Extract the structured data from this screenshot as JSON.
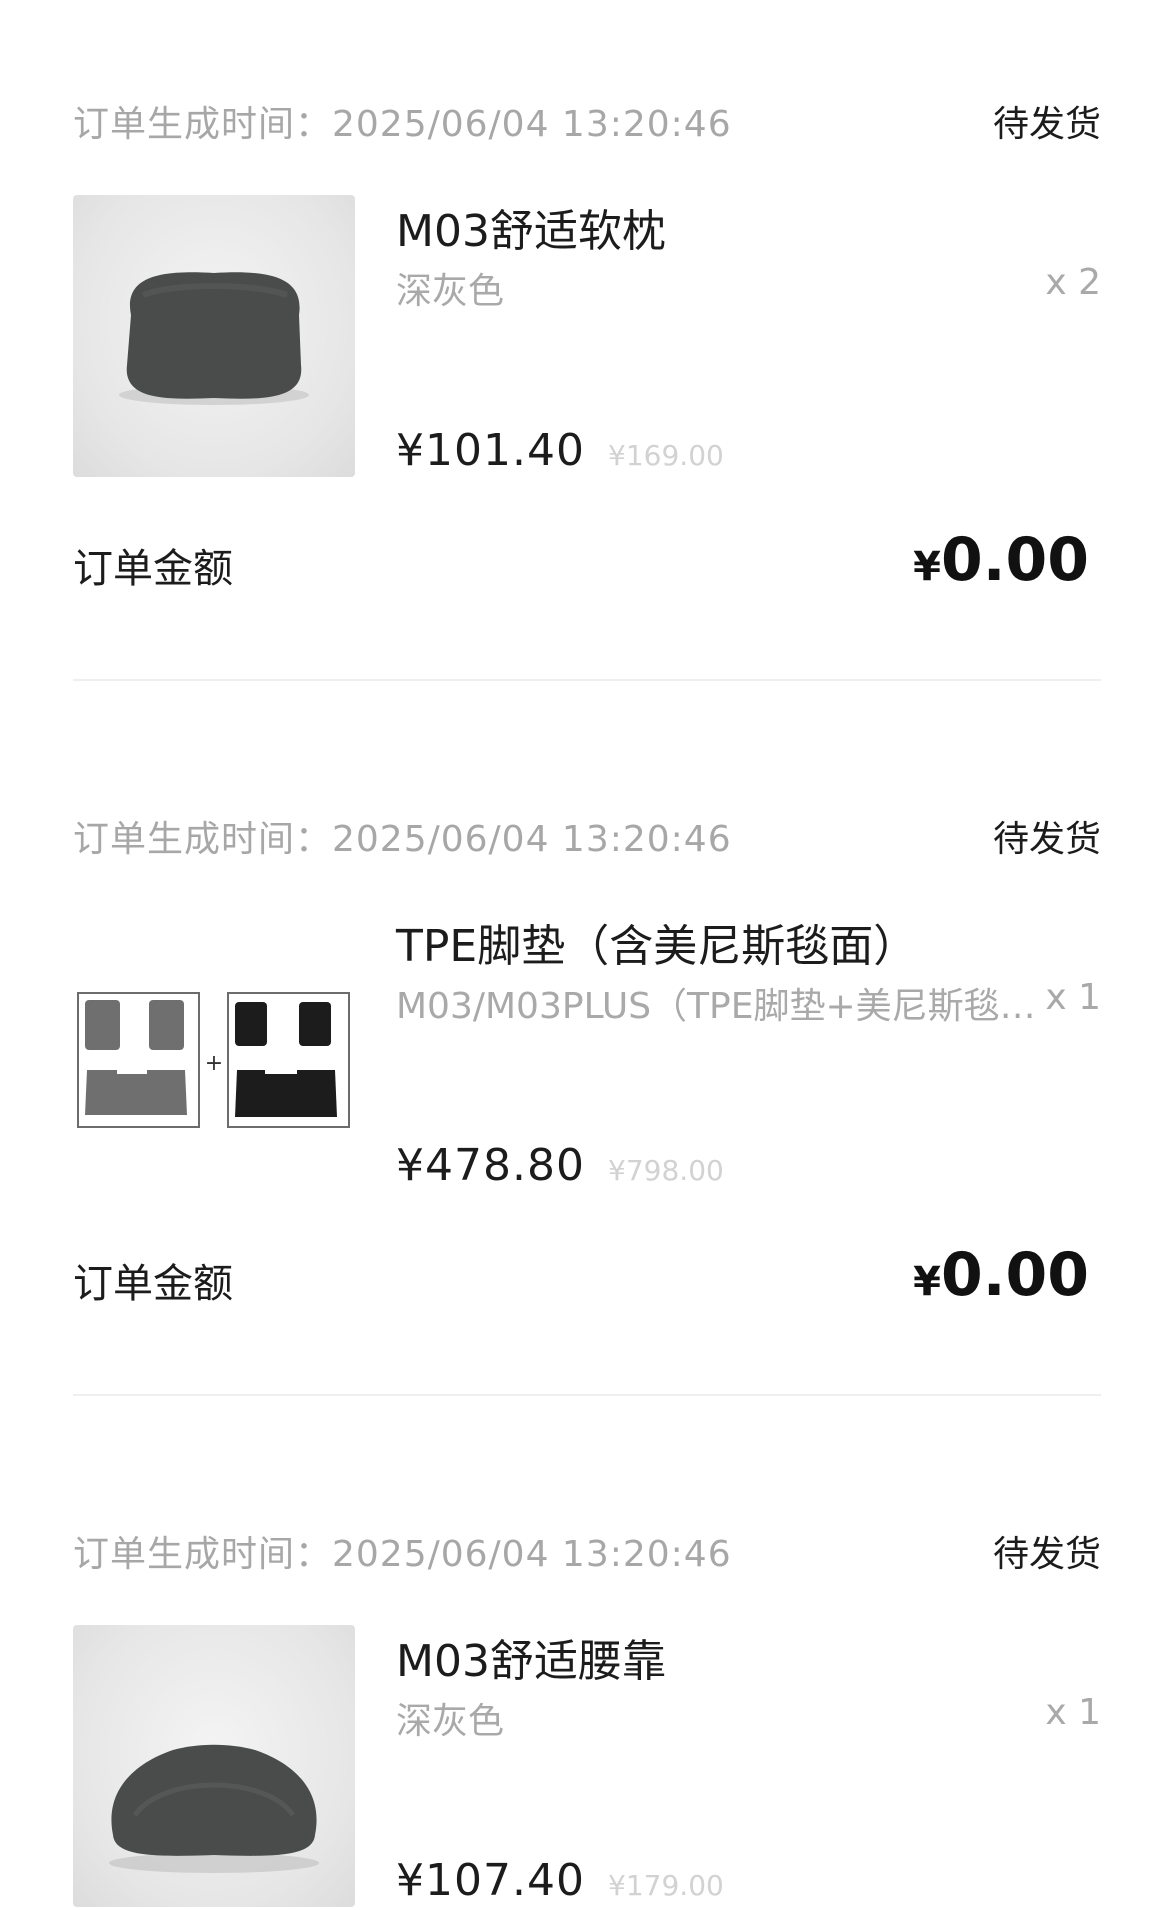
{
  "orders": [
    {
      "time": "订单生成时间：2025/06/04 13:20:46",
      "status": "待发货",
      "product_name": "M03舒适软枕",
      "variant": "深灰色",
      "qty": "x 2",
      "price": "¥101.40",
      "orig_price": "¥169.00",
      "total_label": "订单金额",
      "total_yen": "¥",
      "total_amount": "0.00",
      "image_icon": "headrest-pillow-icon"
    },
    {
      "time": "订单生成时间：2025/06/04 13:20:46",
      "status": "待发货",
      "product_name": "TPE脚垫（含美尼斯毯面）",
      "variant": "M03/M03PLUS（TPE脚垫+美尼斯毯…",
      "qty": "x 1",
      "price": "¥478.80",
      "orig_price": "¥798.00",
      "total_label": "订单金额",
      "total_yen": "¥",
      "total_amount": "0.00",
      "image_icon": "floor-mats-icon",
      "image_plus": "+"
    },
    {
      "time": "订单生成时间：2025/06/04 13:20:46",
      "status": "待发货",
      "product_name": "M03舒适腰靠",
      "variant": "深灰色",
      "qty": "x 1",
      "price": "¥107.40",
      "orig_price": "¥179.00",
      "image_icon": "lumbar-pillow-icon"
    }
  ]
}
